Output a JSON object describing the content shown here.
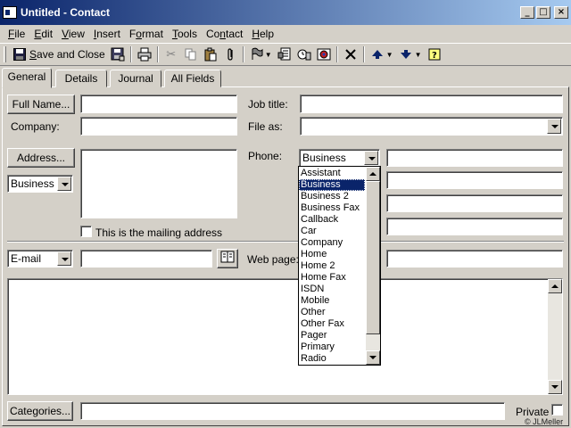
{
  "window": {
    "title": "Untitled - Contact",
    "controls": {
      "minimize": "_",
      "maximize": "□",
      "close": "×"
    }
  },
  "menu": [
    {
      "pre": "",
      "key": "F",
      "post": "ile"
    },
    {
      "pre": "",
      "key": "E",
      "post": "dit"
    },
    {
      "pre": "",
      "key": "V",
      "post": "iew"
    },
    {
      "pre": "",
      "key": "I",
      "post": "nsert"
    },
    {
      "pre": "F",
      "key": "o",
      "post": "rmat"
    },
    {
      "pre": "",
      "key": "T",
      "post": "ools"
    },
    {
      "pre": "Co",
      "key": "n",
      "post": "tact"
    },
    {
      "pre": "",
      "key": "H",
      "post": "elp"
    }
  ],
  "toolbar": {
    "save_close_pre": "",
    "save_close_key": "S",
    "save_close_post": "ave and Close",
    "icons": {
      "save_close": "floppy-disk-icon",
      "save": "save-icon",
      "print": "printer-icon",
      "cut": "scissors-icon",
      "copy": "copy-icon",
      "paste": "clipboard-icon",
      "attach": "paperclip-icon",
      "follow_up": "flag-icon",
      "new_letter": "letter-icon",
      "meeting": "meeting-icon",
      "call": "phone-call-icon",
      "delete": "delete-x-icon",
      "prev": "up-arrow-icon",
      "next": "down-arrow-icon",
      "help": "help-icon"
    }
  },
  "tabs": [
    "General",
    "Details",
    "Journal",
    "All Fields"
  ],
  "form": {
    "full_name_button": "Full Name...",
    "full_name_value": "",
    "job_title_label": "Job title:",
    "job_title_value": "",
    "company_label": "Company:",
    "company_value": "",
    "file_as_label": "File as:",
    "file_as_value": "",
    "address_button": "Address...",
    "address_type": "Business",
    "address_value": "",
    "mailing_checkbox_label": "This is the mailing address",
    "phone_label": "Phone:",
    "phone_type": "Business",
    "email_type": "E-mail",
    "email_value": "",
    "web_page_label": "Web page:",
    "web_page_value": "",
    "notes_value": "",
    "categories_button": "Categories...",
    "categories_value": "",
    "private_label": "Private"
  },
  "phone_options": [
    "Assistant",
    "Business",
    "Business 2",
    "Business Fax",
    "Callback",
    "Car",
    "Company",
    "Home",
    "Home 2",
    "Home Fax",
    "ISDN",
    "Mobile",
    "Other",
    "Other Fax",
    "Pager",
    "Primary",
    "Radio"
  ],
  "phone_selected": "Business",
  "watermark": "© JLMeller",
  "colors": {
    "titlebar_start": "#0a246a",
    "titlebar_end": "#a6caf0",
    "selection": "#0a246a",
    "face": "#d4d0c8"
  }
}
